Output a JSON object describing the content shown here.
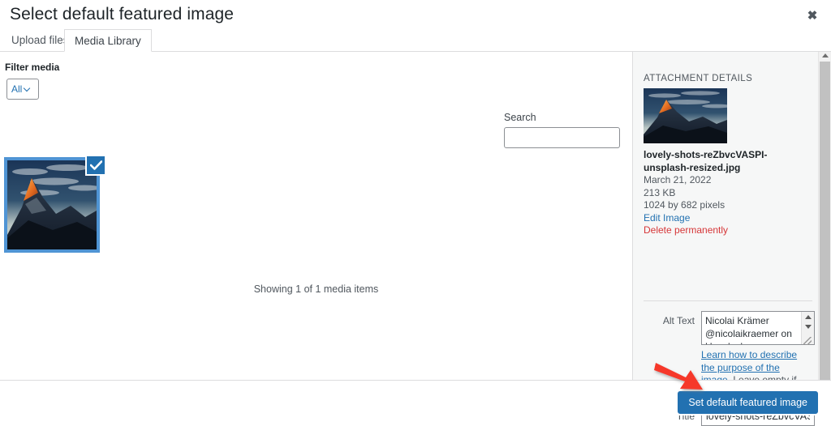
{
  "modal": {
    "title": "Select default featured image",
    "close_label": "✖"
  },
  "tabs": [
    {
      "label": "Upload files",
      "active": false
    },
    {
      "label": "Media Library",
      "active": true
    }
  ],
  "browser": {
    "filter_label": "Filter media",
    "filter_value": "All",
    "search_label": "Search",
    "search_value": "",
    "search_placeholder": "",
    "showing_count": "Showing 1 of 1 media items",
    "attachment_alt": "Mountain peak at sunrise"
  },
  "details": {
    "heading": "ATTACHMENT DETAILS",
    "filename": "lovely-shots-reZbvcVASPI-unsplash-resized.jpg",
    "date": "March 21, 2022",
    "filesize": "213 KB",
    "dimensions": "1024 by 682 pixels",
    "edit_image_label": "Edit Image",
    "delete_label": "Delete permanently",
    "alt_text_label": "Alt Text",
    "alt_text_value": "Nicolai Krämer @nicolaikraemer on Unsplash",
    "alt_help_link": "Learn how to describe the purpose of the image",
    "alt_help_rest": ". Leave empty if the image is purely decorative.",
    "title_label": "Title",
    "title_value": "lovely-shots-reZbvcVASPI-unsplash-resized"
  },
  "footer": {
    "primary_button": "Set default featured image"
  },
  "colors": {
    "accent": "#2271b1",
    "selected_border": "#4f94d4",
    "danger": "#d63638",
    "annotation_arrow": "#f6372b",
    "panel_bg": "#f6f7f7"
  }
}
